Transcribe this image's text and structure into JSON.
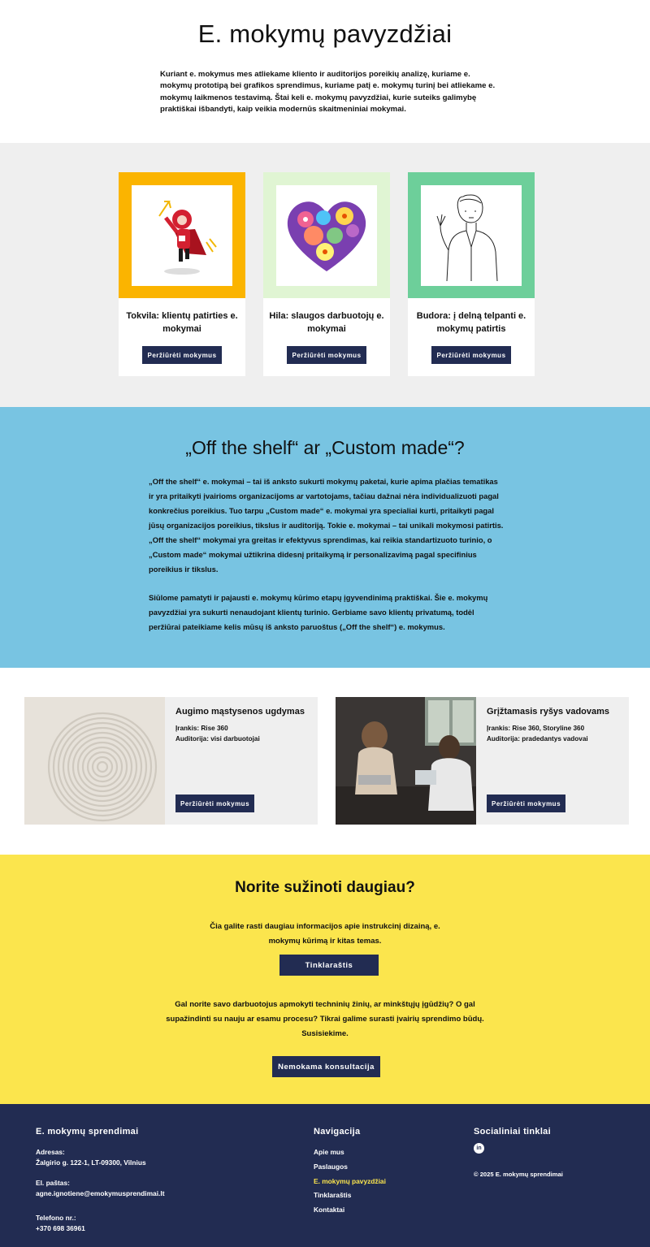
{
  "hero": {
    "title": "E. mokymų pavyzdžiai",
    "intro": "Kuriant e. mokymus mes atliekame kliento ir auditorijos poreikių analizę, kuriame e. mokymų prototipą bei grafikos sprendimus, kuriame patį e. mokymų turinį bei atliekame e. mokymų laikmenos testavimą. Štai keli e. mokymų pavyzdžiai, kurie suteiks galimybę praktiškai išbandyti, kaip veikia modernūs skaitmeniniai mokymai."
  },
  "examples": [
    {
      "title": "Tokvila: klientų patirties e. mokymai",
      "button": "Peržiūrėti mokymus",
      "frame_color": "#fbb400"
    },
    {
      "title": "Hila: slaugos darbuotojų e. mokymai",
      "button": "Peržiūrėti mokymus",
      "frame_color": "#e0f5d3"
    },
    {
      "title": "Budora: į delną telpanti e. mokymų patirtis",
      "button": "Peržiūrėti mokymus",
      "frame_color": "#6dcf9a"
    }
  ],
  "offshelf": {
    "title": "„Off the shelf“ ar „Custom made“?",
    "p1": "„Off the shelf“ e. mokymai – tai iš anksto sukurti mokymų paketai, kurie apima plačias tematikas ir yra pritaikyti įvairioms organizacijoms ar vartotojams, tačiau dažnai nėra individualizuoti pagal konkrečius poreikius. Tuo tarpu „Custom made“ e. mokymai yra specialiai kurti, pritaikyti pagal jūsų organizacijos poreikius, tikslus ir auditoriją. Tokie e. mokymai – tai unikali mokymosi patirtis. „Off the shelf“ mokymai yra greitas ir efektyvus sprendimas, kai reikia standartizuoto turinio, o „Custom made“ mokymai užtikrina didesnį pritaikymą ir personalizavimą pagal specifinius poreikius ir tikslus.",
    "p2": "Siūlome pamatyti ir pajausti e. mokymų kūrimo etapų įgyvendinimą praktiškai. Šie e. mokymų pavyzdžiai yra sukurti nenaudojant klientų turinio. Gerbiame savo klientų privatumą, todėl peržiūrai pateikiame kelis mūsų iš anksto paruoštus („Off the shelf“) e. mokymus."
  },
  "courses": [
    {
      "title": "Augimo mąstysenos ugdymas",
      "tool": "Įrankis: Rise 360",
      "audience": "Auditorija: visi darbuotojai",
      "button": "Peržiūrėti mokymus"
    },
    {
      "title": "Grįžtamasis ryšys vadovams",
      "tool": "Įrankis: Rise 360, Storyline 360",
      "audience": "Auditorija: pradedantys vadovai",
      "button": "Peržiūrėti mokymus"
    }
  ],
  "more": {
    "title": "Norite sužinoti daugiau?",
    "text1": "Čia galite rasti daugiau informacijos apie instrukcinį dizainą, e. mokymų kūrimą ir kitas temas.",
    "blog_button": "Tinklaraštis",
    "text2": "Gal norite savo darbuotojus apmokyti techninių žinių, ar minkštųjų įgūdžių? O gal supažindinti su nauju ar esamu procesu? Tikrai galime surasti įvairių sprendimo būdų. Susisiekime.",
    "consult_button": "Nemokama konsultacija"
  },
  "footer": {
    "brand": "E. mokymų sprendimai",
    "address_label": "Adresas:",
    "address": "Žalgirio g. 122-1, LT-09300, Vilnius",
    "email_label": "El. paštas:",
    "email": "agne.ignotiene@emokymusprendimai.lt",
    "phone_label": "Telefono nr.:",
    "phone": "+370 698 36961",
    "nav_title": "Navigacija",
    "nav": [
      "Apie mus",
      "Paslaugos",
      "E. mokymų pavyzdžiai",
      "Tinklaraštis",
      "Kontaktai"
    ],
    "social_title": "Socialiniai tinklai",
    "linkedin": "in",
    "copyright": "© 2025 E. mokymų sprendimai"
  }
}
